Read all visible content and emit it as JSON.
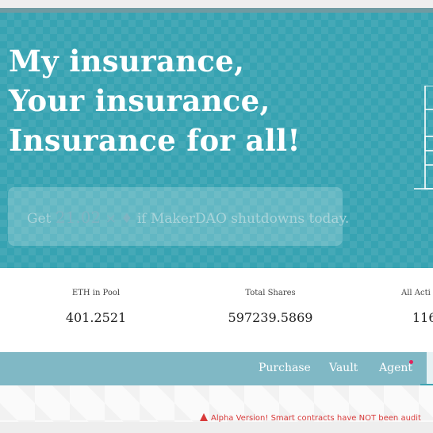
{
  "hero": {
    "headline": [
      "My insurance,",
      "Your insurance,",
      "Insurance for all!"
    ],
    "cta": {
      "prefix": "Get",
      "amount": "21.02",
      "multiplier": "×",
      "eth_symbol": "♦",
      "suffix": "if MakerDAO shutdowns today."
    }
  },
  "stats": [
    {
      "label": "ETH in Pool",
      "value": "401.2521"
    },
    {
      "label": "Total Shares",
      "value": "597239.5869"
    },
    {
      "label": "All Acti",
      "value": "116"
    }
  ],
  "nav": {
    "items": [
      "Purchase",
      "Vault",
      "Agent"
    ]
  },
  "warning": {
    "text": "Alpha Version! Smart contracts have NOT been audit"
  },
  "colors": {
    "hero_bg": "#37a3b2",
    "nav_bg": "#80b8c5",
    "warning": "#d83a3a",
    "notification_dot": "#e0245e"
  }
}
